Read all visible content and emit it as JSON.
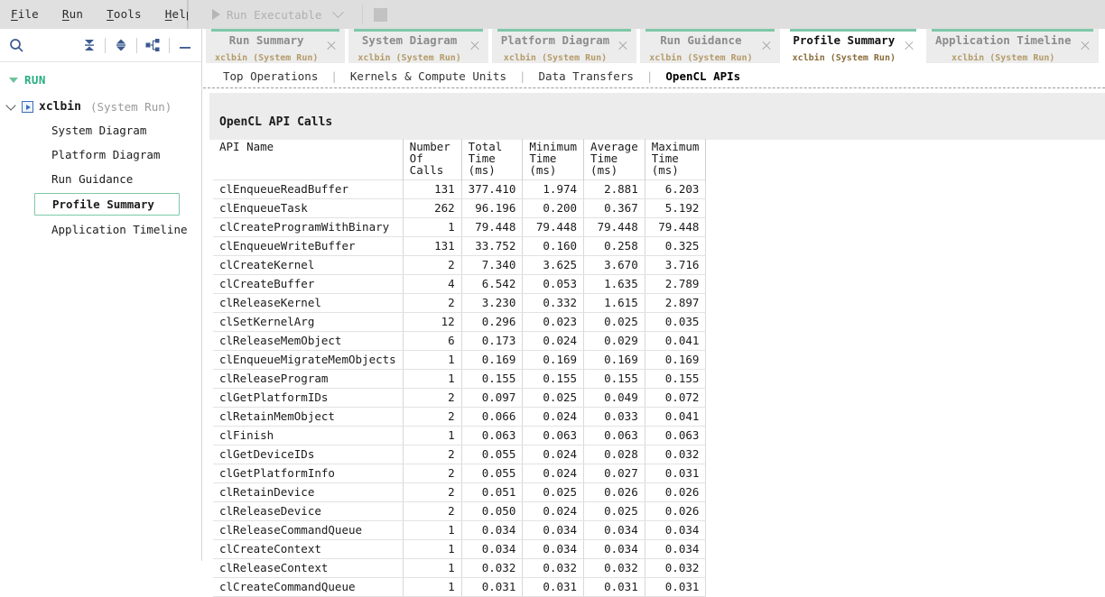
{
  "menu": {
    "items": [
      {
        "label": "File",
        "mnemonic": "F"
      },
      {
        "label": "Run",
        "mnemonic": "R"
      },
      {
        "label": "Tools",
        "mnemonic": "T"
      },
      {
        "label": "Help",
        "mnemonic": "H"
      }
    ],
    "run_executable_label": "Run Executable"
  },
  "sidebar": {
    "toolbar": {
      "search": "search-icon",
      "collapse_all": "collapse-all-icon",
      "expand_collapse": "expand-collapse-icon",
      "hierarchy": "hierarchy-icon",
      "minimize": "minimize-icon"
    },
    "section_label": "RUN",
    "root": {
      "name": "xclbin",
      "sub": "(System Run)"
    },
    "items": [
      {
        "label": "System Diagram",
        "selected": false
      },
      {
        "label": "Platform Diagram",
        "selected": false
      },
      {
        "label": "Run Guidance",
        "selected": false
      },
      {
        "label": "Profile Summary",
        "selected": true
      },
      {
        "label": "Application Timeline",
        "selected": false
      }
    ]
  },
  "tabs": [
    {
      "title": "Run Summary",
      "sub": "xclbin (System Run)",
      "active": false
    },
    {
      "title": "System Diagram",
      "sub": "xclbin (System Run)",
      "active": false
    },
    {
      "title": "Platform Diagram",
      "sub": "xclbin (System Run)",
      "active": false
    },
    {
      "title": "Run Guidance",
      "sub": "xclbin (System Run)",
      "active": false
    },
    {
      "title": "Profile Summary",
      "sub": "xclbin (System Run)",
      "active": true
    },
    {
      "title": "Application Timeline",
      "sub": "xclbin (System Run)",
      "active": false
    }
  ],
  "subtabs": [
    {
      "label": "Top Operations",
      "active": false
    },
    {
      "label": "Kernels & Compute Units",
      "active": false
    },
    {
      "label": "Data Transfers",
      "active": false
    },
    {
      "label": "OpenCL APIs",
      "active": true
    }
  ],
  "table": {
    "caption": "OpenCL API Calls",
    "columns": [
      "API Name",
      "Number\nOf Calls",
      "Total\nTime (ms)",
      "Minimum\nTime (ms)",
      "Average\nTime (ms)",
      "Maximum\nTime (ms)"
    ],
    "rows": [
      [
        "clEnqueueReadBuffer",
        "131",
        "377.410",
        "1.974",
        "2.881",
        "6.203"
      ],
      [
        "clEnqueueTask",
        "262",
        "96.196",
        "0.200",
        "0.367",
        "5.192"
      ],
      [
        "clCreateProgramWithBinary",
        "1",
        "79.448",
        "79.448",
        "79.448",
        "79.448"
      ],
      [
        "clEnqueueWriteBuffer",
        "131",
        "33.752",
        "0.160",
        "0.258",
        "0.325"
      ],
      [
        "clCreateKernel",
        "2",
        "7.340",
        "3.625",
        "3.670",
        "3.716"
      ],
      [
        "clCreateBuffer",
        "4",
        "6.542",
        "0.053",
        "1.635",
        "2.789"
      ],
      [
        "clReleaseKernel",
        "2",
        "3.230",
        "0.332",
        "1.615",
        "2.897"
      ],
      [
        "clSetKernelArg",
        "12",
        "0.296",
        "0.023",
        "0.025",
        "0.035"
      ],
      [
        "clReleaseMemObject",
        "6",
        "0.173",
        "0.024",
        "0.029",
        "0.041"
      ],
      [
        "clEnqueueMigrateMemObjects",
        "1",
        "0.169",
        "0.169",
        "0.169",
        "0.169"
      ],
      [
        "clReleaseProgram",
        "1",
        "0.155",
        "0.155",
        "0.155",
        "0.155"
      ],
      [
        "clGetPlatformIDs",
        "2",
        "0.097",
        "0.025",
        "0.049",
        "0.072"
      ],
      [
        "clRetainMemObject",
        "2",
        "0.066",
        "0.024",
        "0.033",
        "0.041"
      ],
      [
        "clFinish",
        "1",
        "0.063",
        "0.063",
        "0.063",
        "0.063"
      ],
      [
        "clGetDeviceIDs",
        "2",
        "0.055",
        "0.024",
        "0.028",
        "0.032"
      ],
      [
        "clGetPlatformInfo",
        "2",
        "0.055",
        "0.024",
        "0.027",
        "0.031"
      ],
      [
        "clRetainDevice",
        "2",
        "0.051",
        "0.025",
        "0.026",
        "0.026"
      ],
      [
        "clReleaseDevice",
        "2",
        "0.050",
        "0.024",
        "0.025",
        "0.026"
      ],
      [
        "clReleaseCommandQueue",
        "1",
        "0.034",
        "0.034",
        "0.034",
        "0.034"
      ],
      [
        "clCreateContext",
        "1",
        "0.034",
        "0.034",
        "0.034",
        "0.034"
      ],
      [
        "clReleaseContext",
        "1",
        "0.032",
        "0.032",
        "0.032",
        "0.032"
      ],
      [
        "clCreateCommandQueue",
        "1",
        "0.031",
        "0.031",
        "0.031",
        "0.031"
      ]
    ]
  },
  "colors": {
    "accent_green": "#7fc8a9",
    "section_green": "#27ae82",
    "header_gray": "#ececec",
    "menubar_gray": "#e0e0e0",
    "icon_blue": "#3b5a8f",
    "tab_sub_gold": "#8a6d3b"
  }
}
